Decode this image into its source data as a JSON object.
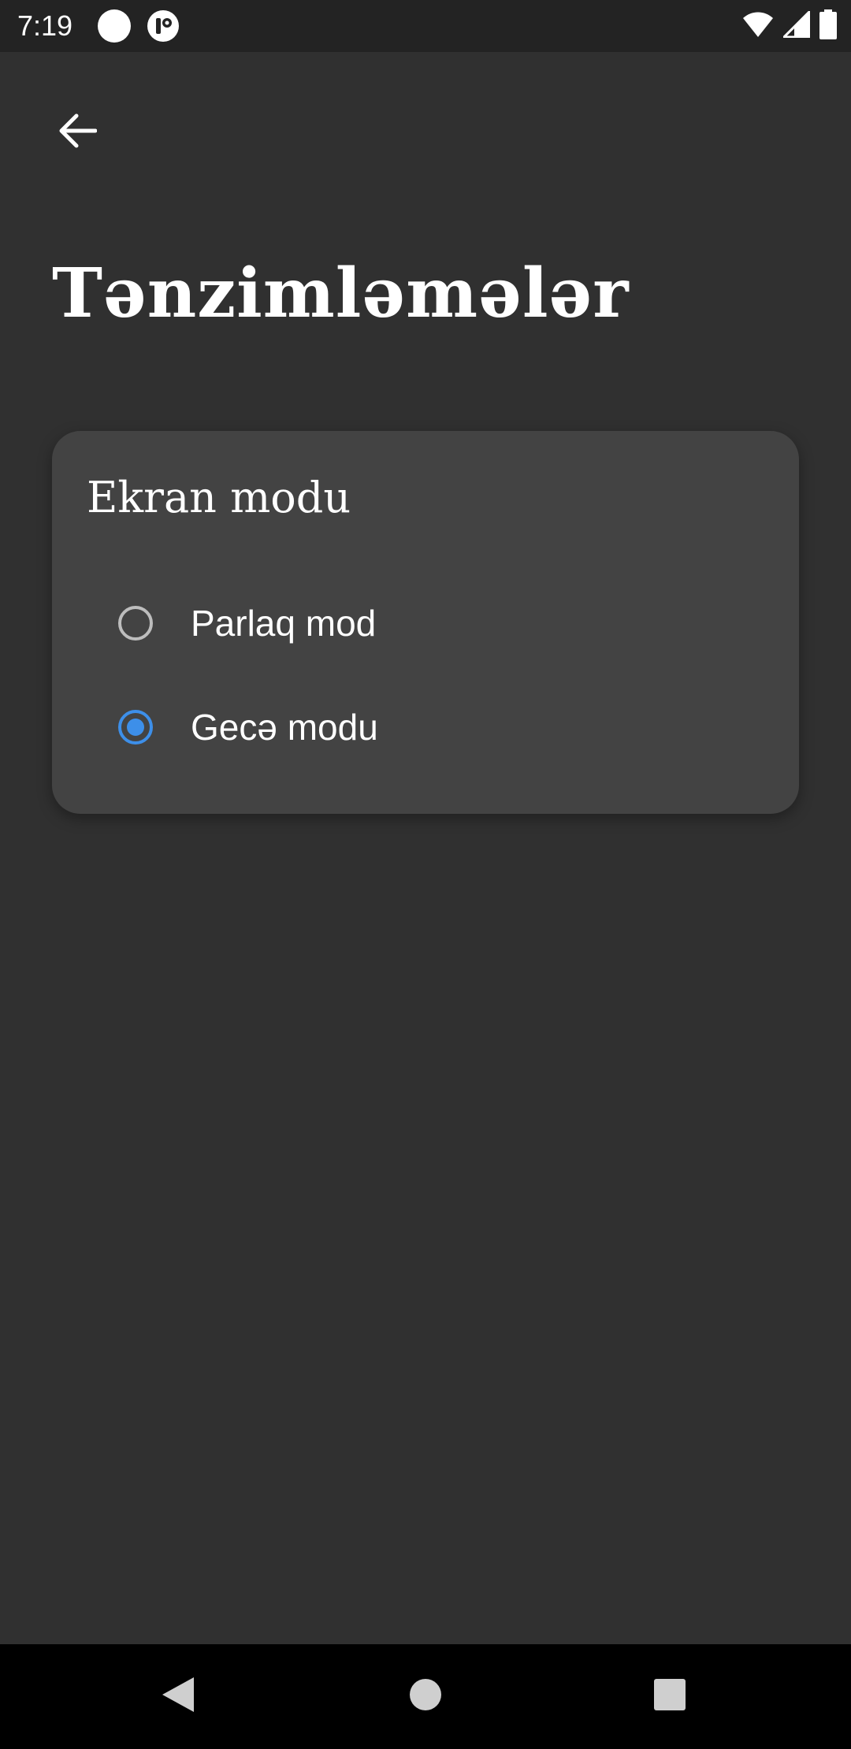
{
  "status_bar": {
    "time": "7:19",
    "icons": [
      "notification-dot-icon",
      "app-notification-icon",
      "wifi-icon",
      "signal-icon",
      "battery-icon"
    ]
  },
  "header": {
    "back_icon": "arrow-back-icon",
    "title": "Tənzimləmələr"
  },
  "display_mode_card": {
    "title": "Ekran modu",
    "options": [
      {
        "label": "Parlaq mod",
        "selected": false
      },
      {
        "label": "Gecə modu",
        "selected": true
      }
    ],
    "accent_color": "#3d8fe9"
  },
  "nav_bar": {
    "icons": [
      "nav-back-icon",
      "nav-home-icon",
      "nav-recents-icon"
    ]
  },
  "colors": {
    "background": "#303030",
    "card": "#434343",
    "status_bar": "#232323",
    "nav_bar": "#000000"
  }
}
